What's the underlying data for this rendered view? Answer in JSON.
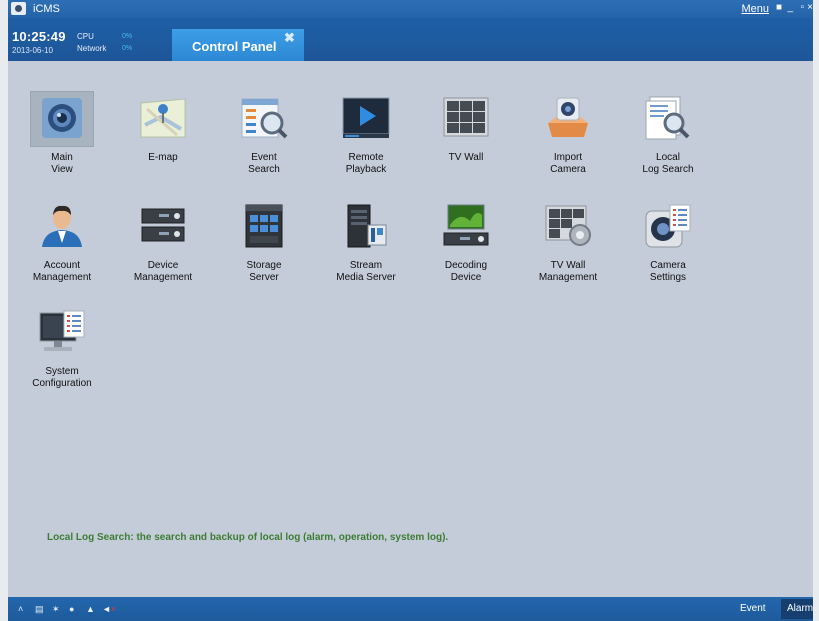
{
  "app": {
    "title": "iCMS"
  },
  "titlebar": {
    "menu_label": "Menu",
    "lock_glyph": "🔒",
    "min_glyph": "_",
    "restore_glyph": "▫",
    "close_glyph": "×"
  },
  "header": {
    "time": "10:25:49",
    "date": "2013-06-10",
    "cpu_label": "CPU",
    "cpu_value": "0%",
    "network_label": "Network",
    "network_value": "0%",
    "tab_label": "Control Panel",
    "tab_close": "✖"
  },
  "panel_items": [
    {
      "id": "main-view",
      "label": "Main\nView",
      "icon": "webcam-icon",
      "selected": true
    },
    {
      "id": "e-map",
      "label": "E-map",
      "icon": "map-icon"
    },
    {
      "id": "event-search",
      "label": "Event\nSearch",
      "icon": "event-search-icon"
    },
    {
      "id": "remote-playback",
      "label": "Remote\nPlayback",
      "icon": "playback-icon"
    },
    {
      "id": "tv-wall",
      "label": "TV Wall",
      "icon": "tv-wall-icon"
    },
    {
      "id": "import-camera",
      "label": "Import\nCamera",
      "icon": "import-camera-icon"
    },
    {
      "id": "local-log-search",
      "label": "Local\nLog Search",
      "icon": "log-search-icon"
    },
    {
      "id": "account-management",
      "label": "Account\nManagement",
      "icon": "user-icon"
    },
    {
      "id": "device-management",
      "label": "Device\nManagement",
      "icon": "dvr-icon"
    },
    {
      "id": "storage-server",
      "label": "Storage\nServer",
      "icon": "storage-icon"
    },
    {
      "id": "stream-media-server",
      "label": "Stream\nMedia Server",
      "icon": "server-icon"
    },
    {
      "id": "decoding-device",
      "label": "Decoding\nDevice",
      "icon": "decoder-icon"
    },
    {
      "id": "tv-wall-management",
      "label": "TV Wall\nManagement",
      "icon": "tv-wall-settings-icon"
    },
    {
      "id": "camera-settings",
      "label": "Camera\nSettings",
      "icon": "camera-settings-icon"
    },
    {
      "id": "system-configuration",
      "label": "System\nConfiguration",
      "icon": "system-config-icon"
    }
  ],
  "status_description": "Local Log Search: the search and backup of local log (alarm, operation, system log).",
  "bottombar": {
    "event_label": "Event",
    "alarm_label": "Alarm",
    "icons": [
      "collapse-icon",
      "monitor-icon",
      "pin-icon",
      "users-icon",
      "person-icon",
      "mute-icon"
    ]
  },
  "colors": {
    "accent": "#2d88d4",
    "header": "#1f5fa6",
    "status_text": "#3d7d34"
  }
}
